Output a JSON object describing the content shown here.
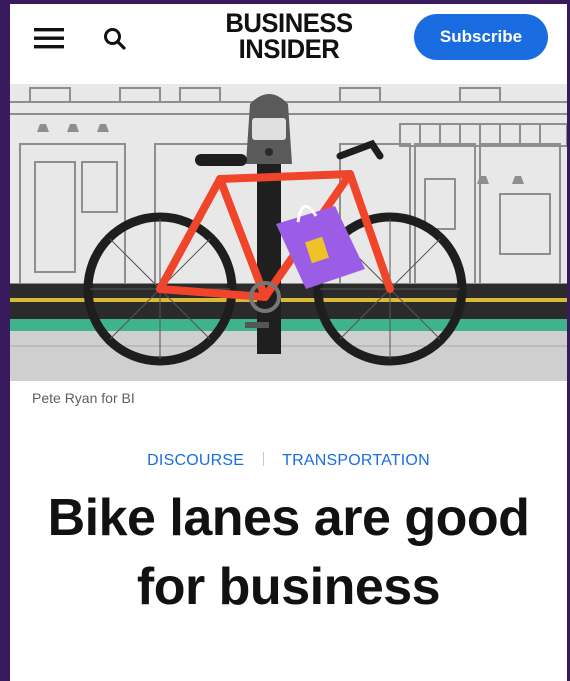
{
  "header": {
    "menu_icon": "hamburger-menu-icon",
    "search_icon": "search-icon",
    "logo_line1": "BUSINESS",
    "logo_line2": "INSIDER",
    "subscribe_label": "Subscribe"
  },
  "article": {
    "image_credit": "Pete Ryan for BI",
    "tags": [
      "DISCOURSE",
      "TRANSPORTATION"
    ],
    "headline": "Bike lanes are good for business"
  },
  "colors": {
    "accent": "#1a6de0",
    "frame": "#3a1a5e",
    "bike_frame": "#f0452a",
    "bag": "#9b5de5",
    "bike_lane": "#3fb28e"
  }
}
